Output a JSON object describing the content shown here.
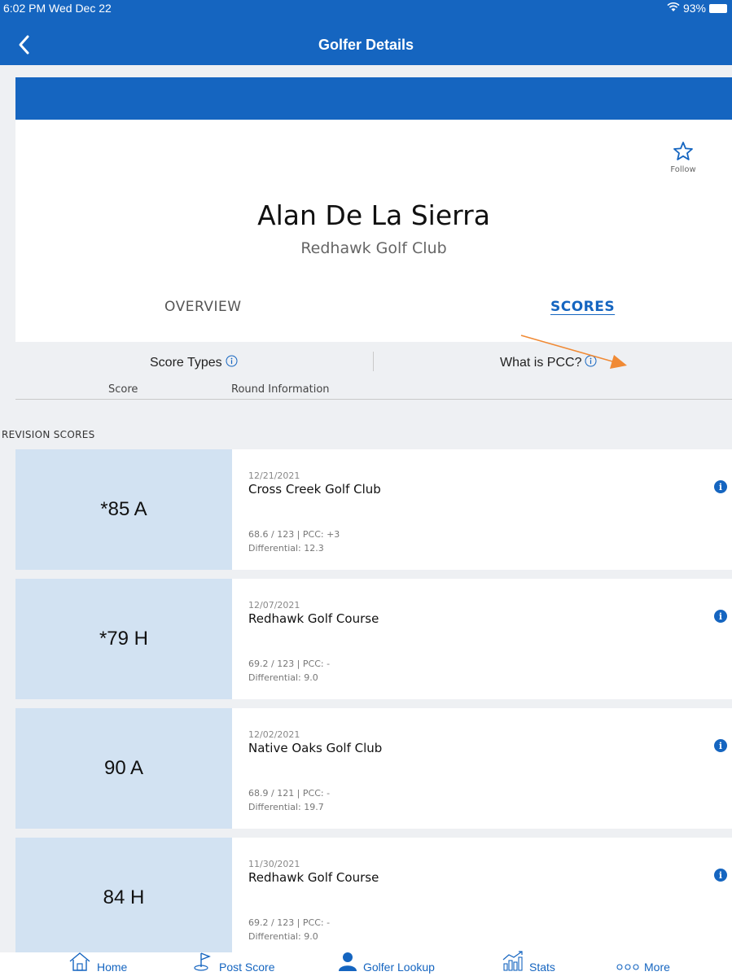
{
  "status_bar": {
    "time": "6:02 PM  Wed Dec 22",
    "battery": "93%"
  },
  "header": {
    "title": "Golfer Details"
  },
  "profile": {
    "name": "Alan De La Sierra",
    "club": "Redhawk Golf Club",
    "follow_label": "Follow"
  },
  "tabs": [
    {
      "label": "OVERVIEW",
      "active": false
    },
    {
      "label": "SCORES",
      "active": true
    }
  ],
  "tools": {
    "score_types": "Score Types",
    "what_is_pcc": "What is PCC?"
  },
  "columns": {
    "score": "Score",
    "round_info": "Round Information"
  },
  "section_label": "REVISION SCORES",
  "scores": [
    {
      "score": "*85 A",
      "date": "12/21/2021",
      "course": "Cross Creek Golf Club",
      "rating": "68.6 / 123 | PCC: +3",
      "differential": "Differential: 12.3"
    },
    {
      "score": "*79 H",
      "date": "12/07/2021",
      "course": "Redhawk Golf Course",
      "rating": "69.2 / 123 | PCC: -",
      "differential": "Differential: 9.0"
    },
    {
      "score": "90 A",
      "date": "12/02/2021",
      "course": "Native Oaks Golf Club",
      "rating": "68.9 / 121 | PCC: -",
      "differential": "Differential: 19.7"
    },
    {
      "score": "84 H",
      "date": "11/30/2021",
      "course": "Redhawk Golf Course",
      "rating": "69.2 / 123 | PCC: -",
      "differential": "Differential: 9.0"
    }
  ],
  "bottom_nav": [
    {
      "label": "Home",
      "icon": "home-icon"
    },
    {
      "label": "Post Score",
      "icon": "golf-flag-icon"
    },
    {
      "label": "Golfer Lookup",
      "icon": "person-icon"
    },
    {
      "label": "Stats",
      "icon": "stats-chart-icon"
    },
    {
      "label": "More",
      "icon": "more-dots-icon"
    }
  ],
  "colors": {
    "brand_blue": "#1565c0",
    "score_box": "#d2e2f2",
    "annotation_arrow": "#f08a35"
  }
}
